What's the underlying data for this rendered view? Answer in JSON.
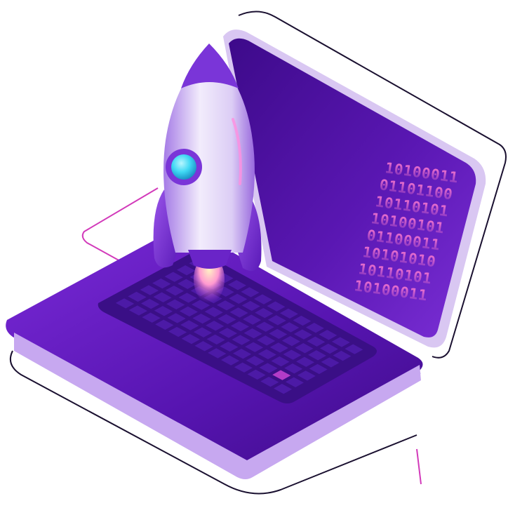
{
  "scene": {
    "binary_lines": [
      "10100011",
      "01101100",
      "10110101",
      "10100101",
      "01100011",
      "10101010",
      "10110101",
      "10100011"
    ]
  },
  "colors": {
    "background": "#ffffff",
    "screen_dark": "#4a0f9e",
    "screen_light": "#6a24c8",
    "bezel": "#d9c7f2",
    "base_top": "#5e1bbd",
    "key": "#3f1190",
    "rocket_body": "#e6dcf7",
    "rocket_accent": "#7a35d8",
    "window_glass": "#35d6f2",
    "binary_text": "#ff7bd0",
    "outline_dark": "#1a1030",
    "outline_pink": "#e040c0"
  }
}
